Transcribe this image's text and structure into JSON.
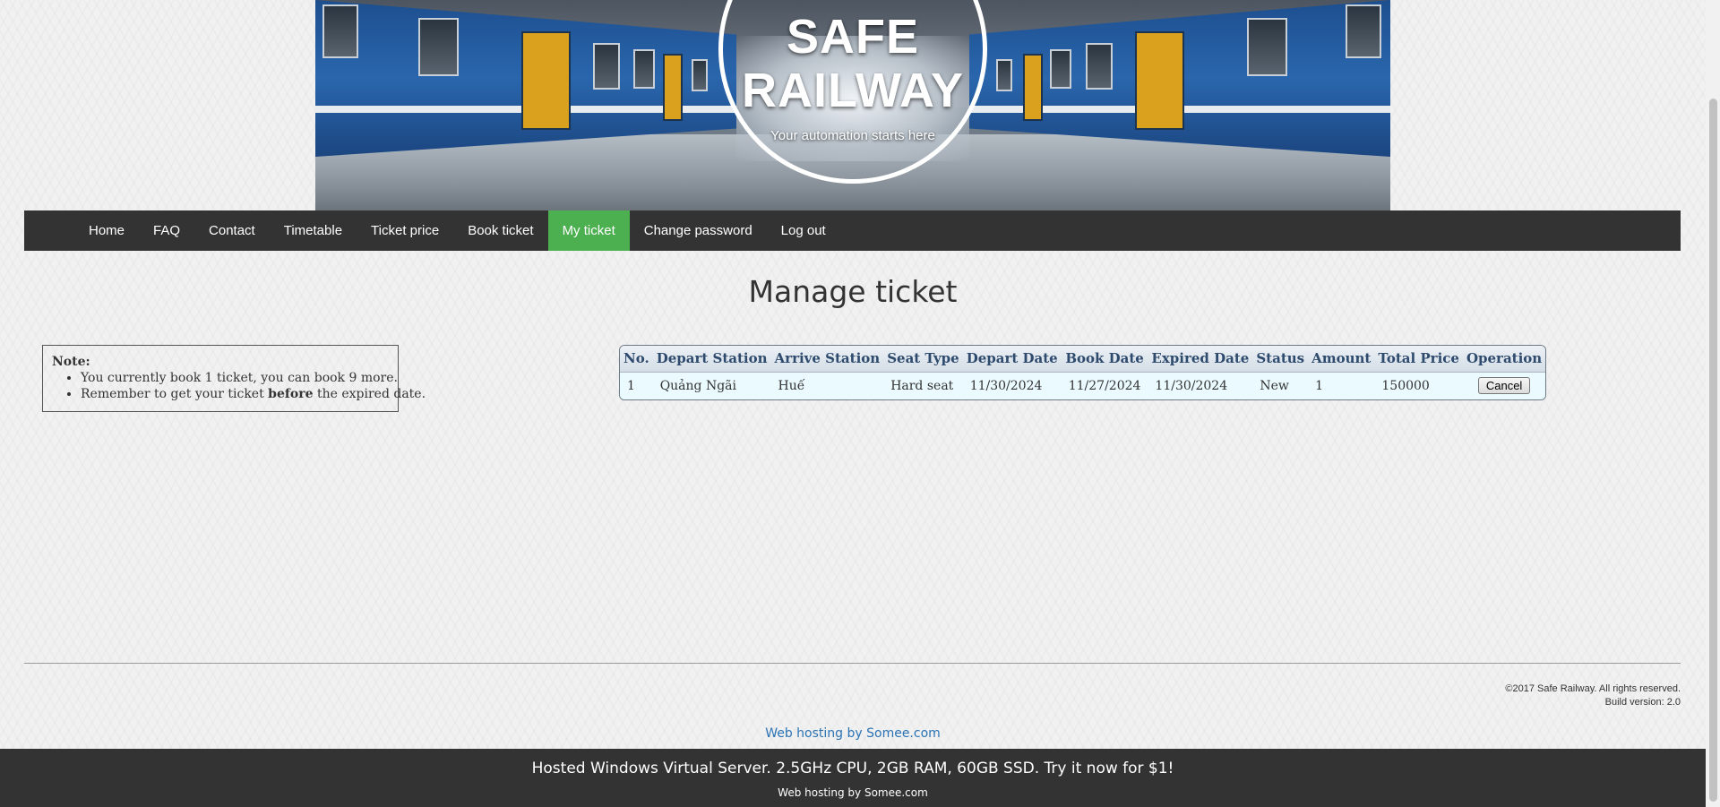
{
  "brand": {
    "title_line1": "SAFE",
    "title_line2": "RAILWAY",
    "tagline": "Your automation starts here"
  },
  "nav": {
    "items": [
      {
        "label": "Home"
      },
      {
        "label": "FAQ"
      },
      {
        "label": "Contact"
      },
      {
        "label": "Timetable"
      },
      {
        "label": "Ticket price"
      },
      {
        "label": "Book ticket"
      },
      {
        "label": "My ticket",
        "active": true
      },
      {
        "label": "Change password"
      },
      {
        "label": "Log out"
      }
    ],
    "active_color": "#4caf50",
    "bar_color": "#333333"
  },
  "page": {
    "title": "Manage ticket"
  },
  "note": {
    "title": "Note:",
    "line1": "You currently book 1 ticket, you can book 9 more.",
    "line2_before": "Remember to get your ticket ",
    "line2_bold": "before",
    "line2_after": " the expired date."
  },
  "tickets": {
    "headers": [
      "No.",
      "Depart Station",
      "Arrive Station",
      "Seat Type",
      "Depart Date",
      "Book Date",
      "Expired Date",
      "Status",
      "Amount",
      "Total Price",
      "Operation"
    ],
    "rows": [
      {
        "no": "1",
        "depart_station": "Quảng Ngãi",
        "arrive_station": "Huế",
        "seat_type": "Hard seat",
        "depart_date": "11/30/2024",
        "book_date": "11/27/2024",
        "expired_date": "11/30/2024",
        "status": "New",
        "amount": "1",
        "total_price": "150000",
        "operation_label": "Cancel"
      }
    ]
  },
  "footer": {
    "copyright": "©2017 Safe Railway. All rights reserved.",
    "build": "Build version: 2.0",
    "host_link": "Web hosting by Somee.com",
    "ad_main": "Hosted Windows Virtual Server. 2.5GHz CPU, 2GB RAM, 60GB SSD. Try it now for $1!",
    "ad_sub": "Web hosting by Somee.com"
  }
}
